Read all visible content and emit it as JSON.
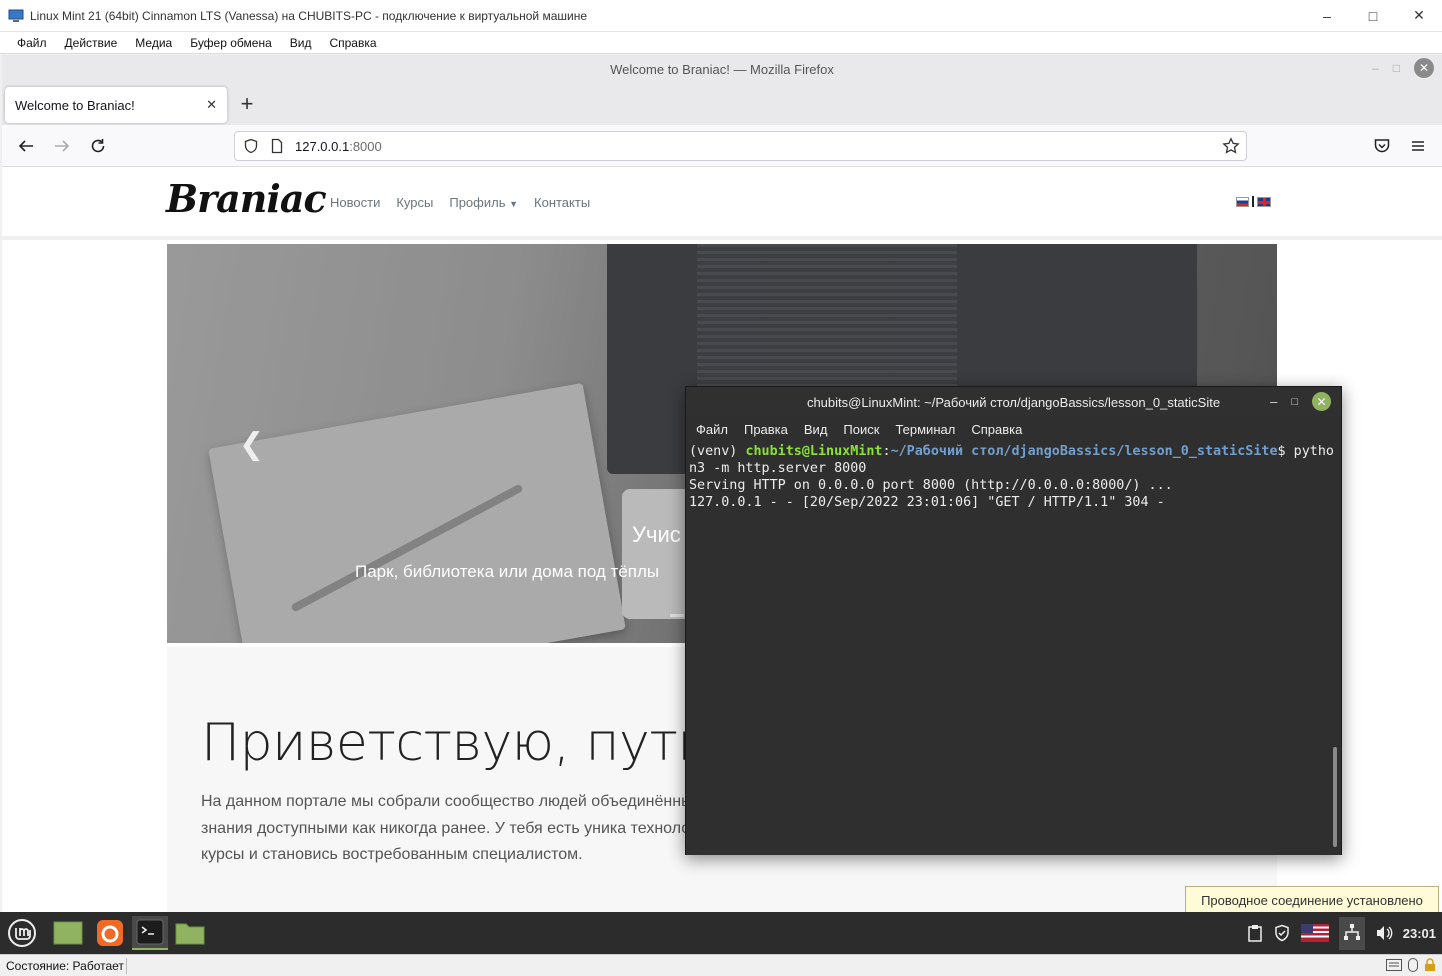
{
  "vm_window": {
    "title": "Linux Mint 21 (64bit) Cinnamon LTS (Vanessa) на CHUBITS-PC - подключение к виртуальной машине",
    "menu": [
      "Файл",
      "Действие",
      "Медиа",
      "Буфер обмена",
      "Вид",
      "Справка"
    ],
    "status": "Состояние: Работает"
  },
  "firefox": {
    "window_title": "Welcome to Braniac! — Mozilla Firefox",
    "tab_title": "Welcome to Braniac!",
    "url_host": "127.0.0.1",
    "url_port": ":8000"
  },
  "site": {
    "brand": "Braniac",
    "nav": [
      "Новости",
      "Курсы",
      "Профиль",
      "Контакты"
    ],
    "hero_caption_title": "Учис",
    "hero_caption_text": "Парк, библиотека или дома под тёплы",
    "heading": "Приветствую, путни",
    "lead": "На данном портале мы собрали сообщество людей объединённы представить человека не общающегося с компьютером. Повсеме сделать знания доступными как никогда ранее. У тебя есть уника технологии. Не упусти свой шанс и переходи на вкладку \"Курсы\", записывайся на курсы и становись востребованным специалистом."
  },
  "terminal": {
    "title": "chubits@LinuxMint: ~/Рабочий стол/djangoBassics/lesson_0_staticSite",
    "menu": [
      "Файл",
      "Правка",
      "Вид",
      "Поиск",
      "Терминал",
      "Справка"
    ],
    "prompt_venv": "(venv) ",
    "prompt_user": "chubits@LinuxMint",
    "prompt_colon": ":",
    "prompt_path": "~/Рабочий стол/djangoBassics/lesson_0_staticSite",
    "prompt_cmd": "$ pytho",
    "line2": "n3 -m http.server 8000",
    "line3": "Serving HTTP on 0.0.0.0 port 8000 (http://0.0.0.0:8000/) ...",
    "line4": "127.0.0.1 - - [20/Sep/2022 23:01:06] \"GET / HTTP/1.1\" 304 -"
  },
  "panel": {
    "tooltip": "Проводное соединение установлено",
    "clock": "23:01",
    "accent": "#8fb360"
  }
}
